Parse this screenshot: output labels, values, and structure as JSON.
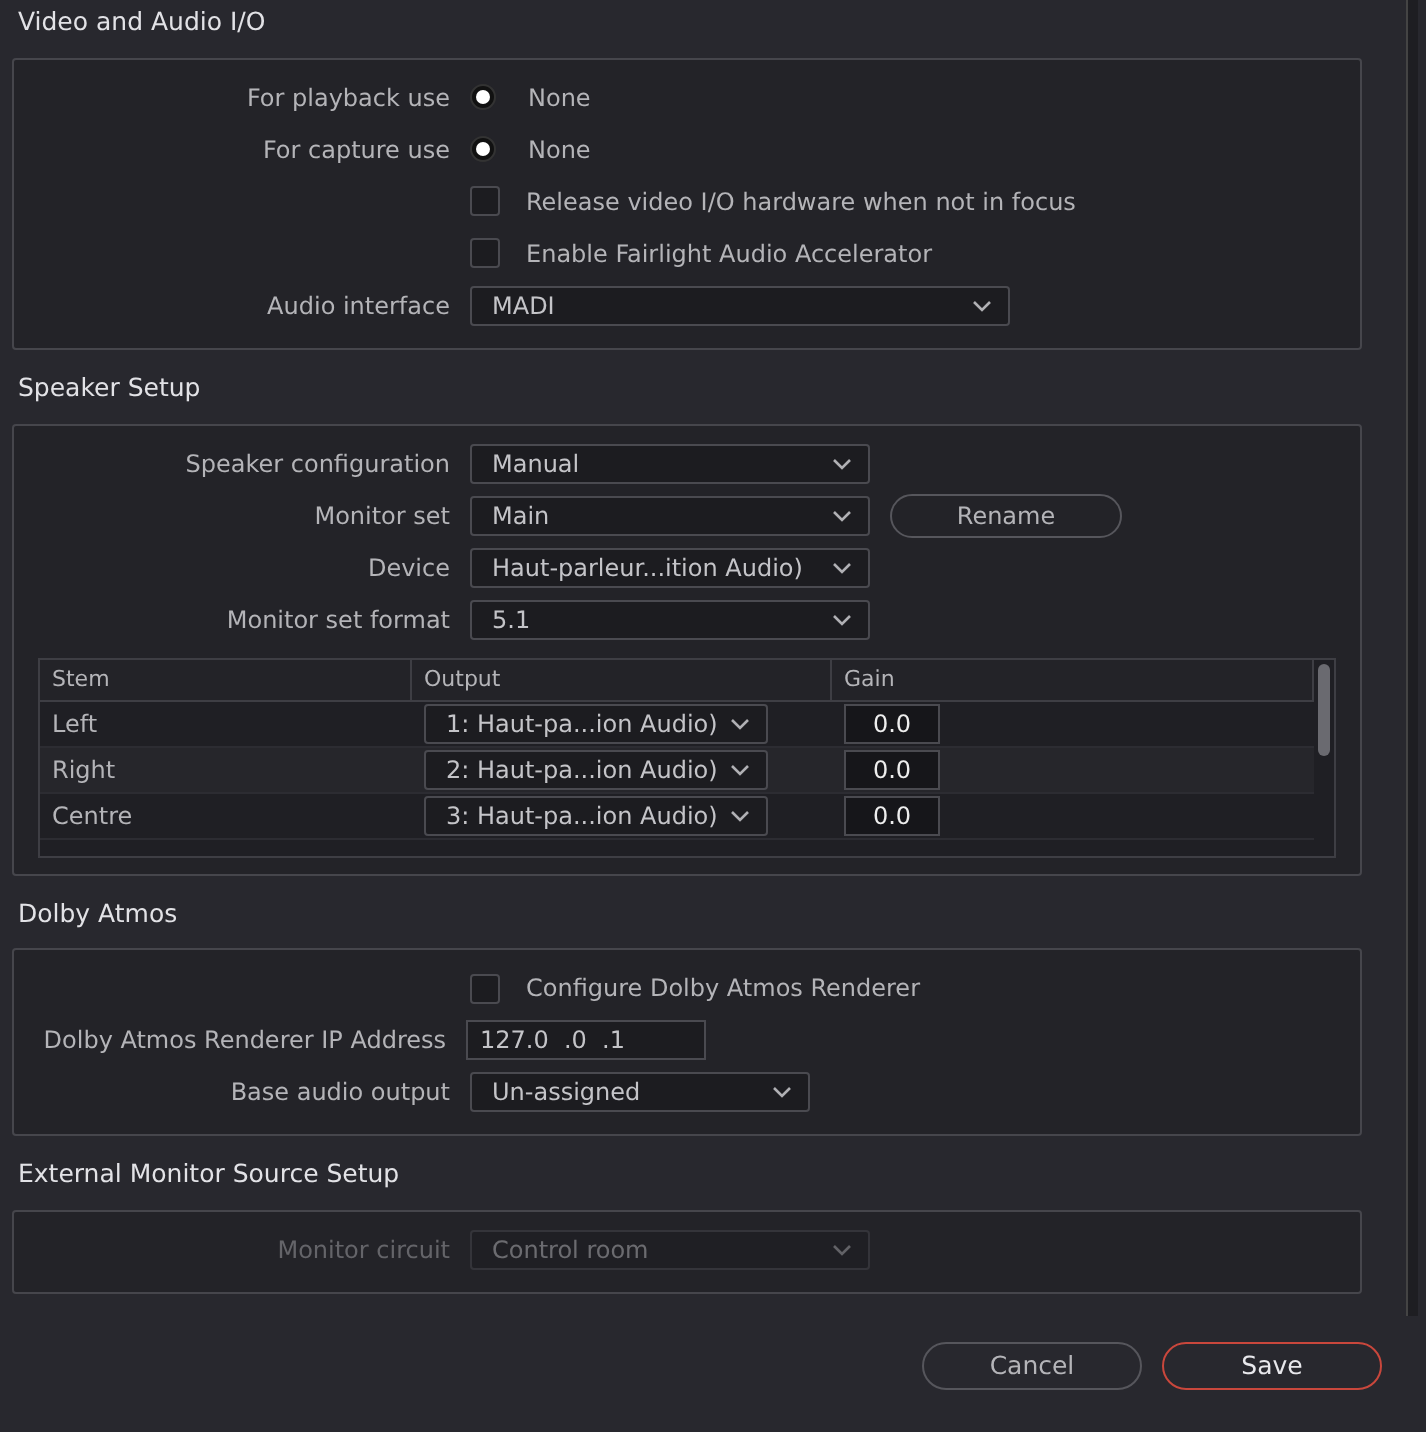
{
  "sections": [
    {
      "title": "Video and Audio I/O",
      "rows": [
        {
          "kind": "radio",
          "label": "For playback use",
          "option": "None",
          "checked": true
        },
        {
          "kind": "radio",
          "label": "For capture use",
          "option": "None",
          "checked": true
        },
        {
          "kind": "checkbox",
          "text": "Release video I/O hardware when not in focus",
          "checked": false
        },
        {
          "kind": "checkbox",
          "text": "Enable Fairlight Audio Accelerator",
          "checked": false
        },
        {
          "kind": "dropdown",
          "label": "Audio interface",
          "value": "MADI"
        }
      ]
    },
    {
      "title": "Speaker Setup",
      "rows": [
        {
          "kind": "dropdown",
          "label": "Speaker configuration",
          "value": "Manual"
        },
        {
          "kind": "dropdown",
          "label": "Monitor set",
          "value": "Main",
          "button": "Rename"
        },
        {
          "kind": "dropdown",
          "label": "Device",
          "value": "Haut-parleur...ition Audio)"
        },
        {
          "kind": "dropdown",
          "label": "Monitor set format",
          "value": "5.1"
        },
        {
          "kind": "table",
          "columns": [
            "Stem",
            "Output",
            "Gain"
          ],
          "rows": [
            {
              "stem": "Left",
              "output": "1: Haut-pa...ion Audio)",
              "gain": "0.0"
            },
            {
              "stem": "Right",
              "output": "2: Haut-pa...ion Audio)",
              "gain": "0.0"
            },
            {
              "stem": "Centre",
              "output": "3: Haut-pa...ion Audio)",
              "gain": "0.0"
            }
          ]
        }
      ]
    },
    {
      "title": "Dolby Atmos",
      "rows": [
        {
          "kind": "checkbox",
          "text": "Configure Dolby Atmos Renderer",
          "checked": false
        },
        {
          "kind": "text_input",
          "label": "Dolby Atmos Renderer IP Address",
          "value": "127.0  .0  .1"
        },
        {
          "kind": "dropdown",
          "label": "Base audio output",
          "value": "Un-assigned"
        }
      ]
    },
    {
      "title": "External Monitor Source Setup",
      "rows": [
        {
          "kind": "dropdown",
          "label": "Monitor circuit",
          "value": "Control room",
          "disabled": true
        }
      ]
    }
  ],
  "footer": {
    "buttons": [
      {
        "label": "Cancel",
        "kind": "secondary"
      },
      {
        "label": "Save",
        "kind": "primary"
      }
    ]
  }
}
